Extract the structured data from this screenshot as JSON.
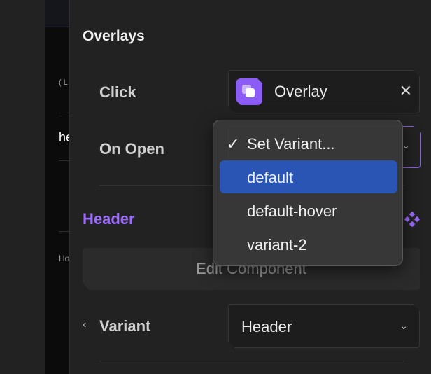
{
  "canvas": {
    "snippet_1": "( L",
    "snippet_2": "he",
    "snippet_3": "Ho"
  },
  "panel": {
    "section_title": "Overlays",
    "click": {
      "label": "Click",
      "value": "Overlay",
      "icon": "overlay-icon",
      "clear_glyph": "✕"
    },
    "on_open": {
      "label": "On Open",
      "chevron": "⌄"
    },
    "header": {
      "title": "Header",
      "title_color": "#9d6bff",
      "edit_button": "Edit Component"
    },
    "variant": {
      "back_glyph": "‹",
      "label": "Variant",
      "value": "Header",
      "chevron": "⌄"
    }
  },
  "dropdown": {
    "check_glyph": "✓",
    "items": [
      {
        "label": "Set Variant...",
        "checked": true,
        "highlighted": false
      },
      {
        "label": "default",
        "checked": false,
        "highlighted": true
      },
      {
        "label": "default-hover",
        "checked": false,
        "highlighted": false
      },
      {
        "label": "variant-2",
        "checked": false,
        "highlighted": false
      }
    ],
    "highlight_color": "#2a55b5"
  }
}
